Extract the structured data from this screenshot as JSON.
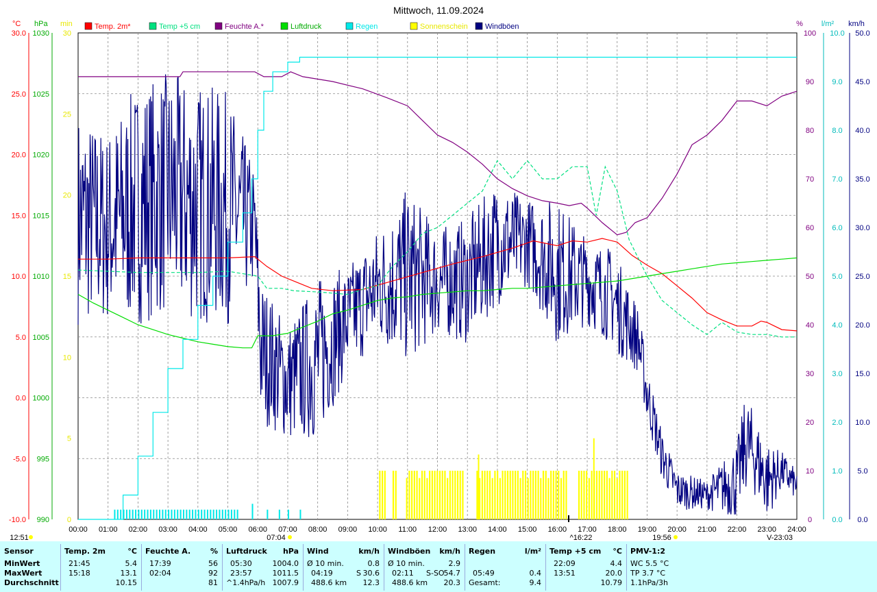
{
  "chart_data": {
    "type": "line",
    "title": "Mittwoch, 11.09.2024",
    "x_ticks": [
      "00:00",
      "01:00",
      "02:00",
      "03:00",
      "04:00",
      "05:00",
      "06:00",
      "07:00",
      "08:00",
      "09:00",
      "10:00",
      "11:00",
      "12:00",
      "13:00",
      "14:00",
      "15:00",
      "16:00",
      "17:00",
      "18:00",
      "19:00",
      "20:00",
      "21:00",
      "22:00",
      "23:00",
      "24:00"
    ],
    "axes": {
      "temp": {
        "unit": "°C",
        "min": -10,
        "max": 30,
        "ticks": [
          "30.0",
          "25.0",
          "20.0",
          "15.0",
          "10.0",
          "5.0",
          "0.0",
          "-5.0",
          "-10.0"
        ]
      },
      "press": {
        "unit": "hPa",
        "min": 990,
        "max": 1030,
        "ticks": [
          "1030",
          "1025",
          "1020",
          "1015",
          "1010",
          "1005",
          "1000",
          "995",
          "990"
        ]
      },
      "sun": {
        "unit": "min",
        "min": 0,
        "max": 30,
        "ticks": [
          "30",
          "25",
          "20",
          "15",
          "10",
          "5",
          "0"
        ]
      },
      "hum": {
        "unit": "%",
        "min": 0,
        "max": 100,
        "ticks": [
          "100",
          "90",
          "80",
          "70",
          "60",
          "50",
          "40",
          "30",
          "20",
          "10",
          "0"
        ]
      },
      "rain": {
        "unit": "l/m²",
        "min": 0,
        "max": 10,
        "ticks": [
          "10.0",
          "9.0",
          "8.0",
          "7.0",
          "6.0",
          "5.0",
          "4.0",
          "3.0",
          "2.0",
          "1.0",
          "0.0"
        ]
      },
      "wind": {
        "unit": "km/h",
        "min": 0,
        "max": 50,
        "ticks": [
          "50.0",
          "45.0",
          "40.0",
          "35.0",
          "30.0",
          "25.0",
          "20.0",
          "15.0",
          "10.0",
          "5.0",
          "0.0"
        ]
      }
    },
    "legend": [
      {
        "name": "Temp. 2m*",
        "color": "#ff0000"
      },
      {
        "name": "Temp +5 cm",
        "color": "#00e080"
      },
      {
        "name": "Feuchte A.*",
        "color": "#800080"
      },
      {
        "name": "Luftdruck",
        "color": "#00dd00"
      },
      {
        "name": "Regen",
        "color": "#00e8e8"
      },
      {
        "name": "Sonnenschein",
        "color": "#ffff00"
      },
      {
        "name": "Windböen",
        "color": "#000080"
      }
    ],
    "series": [
      {
        "name": "Temp. 2m*",
        "axis": "temp",
        "color": "#ff0000",
        "style": "solid",
        "points": [
          [
            0,
            11.4
          ],
          [
            1,
            11.4
          ],
          [
            2,
            11.5
          ],
          [
            3,
            11.5
          ],
          [
            4,
            11.5
          ],
          [
            5,
            11.5
          ],
          [
            5.9,
            11.6
          ],
          [
            6.3,
            10.8
          ],
          [
            6.8,
            10
          ],
          [
            7.3,
            9.5
          ],
          [
            7.8,
            9
          ],
          [
            8.5,
            8.8
          ],
          [
            9.5,
            8.9
          ],
          [
            10.5,
            9.6
          ],
          [
            11.5,
            10.3
          ],
          [
            12.5,
            11
          ],
          [
            13.5,
            11.6
          ],
          [
            14.5,
            12.3
          ],
          [
            15.2,
            12.9
          ],
          [
            16,
            12.5
          ],
          [
            16.5,
            12.9
          ],
          [
            17,
            12.8
          ],
          [
            17.5,
            13.1
          ],
          [
            18,
            12.8
          ],
          [
            18.5,
            11.7
          ],
          [
            19,
            10.9
          ],
          [
            19.5,
            10.2
          ],
          [
            20,
            9.2
          ],
          [
            20.5,
            8.2
          ],
          [
            21,
            7
          ],
          [
            21.5,
            6.4
          ],
          [
            22,
            5.9
          ],
          [
            22.5,
            5.9
          ],
          [
            22.8,
            6.3
          ],
          [
            23,
            6.2
          ],
          [
            23.5,
            5.6
          ],
          [
            24,
            5.5
          ]
        ]
      },
      {
        "name": "Temp +5 cm",
        "axis": "temp",
        "color": "#00e080",
        "style": "dashed",
        "points": [
          [
            0,
            10.5
          ],
          [
            1,
            10.4
          ],
          [
            2,
            10.3
          ],
          [
            3,
            10.3
          ],
          [
            4,
            10.3
          ],
          [
            5,
            10.4
          ],
          [
            6,
            10
          ],
          [
            6.3,
            9
          ],
          [
            6.8,
            9
          ],
          [
            7.2,
            8.8
          ],
          [
            8,
            8.7
          ],
          [
            9,
            8.5
          ],
          [
            9.6,
            9
          ],
          [
            10,
            9.2
          ],
          [
            10.5,
            10.8
          ],
          [
            11,
            12
          ],
          [
            11.5,
            13.5
          ],
          [
            12,
            14
          ],
          [
            12.5,
            15
          ],
          [
            13,
            16
          ],
          [
            13.5,
            17
          ],
          [
            14,
            19.5
          ],
          [
            14.5,
            18
          ],
          [
            15,
            19.5
          ],
          [
            15.5,
            18
          ],
          [
            16,
            18
          ],
          [
            16.5,
            19
          ],
          [
            17,
            19
          ],
          [
            17.3,
            15
          ],
          [
            17.6,
            19
          ],
          [
            18,
            17
          ],
          [
            18.4,
            13
          ],
          [
            19,
            10
          ],
          [
            19.5,
            8
          ],
          [
            20,
            7
          ],
          [
            20.5,
            6
          ],
          [
            21,
            5.2
          ],
          [
            21.5,
            6.2
          ],
          [
            22,
            5.4
          ],
          [
            22.5,
            5.2
          ],
          [
            23,
            5.2
          ],
          [
            23.5,
            5
          ],
          [
            24,
            5
          ]
        ]
      },
      {
        "name": "Feuchte A.*",
        "axis": "hum",
        "color": "#800080",
        "style": "solid",
        "points": [
          [
            0,
            91
          ],
          [
            3.4,
            91
          ],
          [
            3.5,
            92
          ],
          [
            5.9,
            92
          ],
          [
            6.2,
            91
          ],
          [
            6.8,
            91
          ],
          [
            7.1,
            92
          ],
          [
            7.5,
            91
          ],
          [
            8.5,
            90
          ],
          [
            9.5,
            88.5
          ],
          [
            10.3,
            86.7
          ],
          [
            11,
            85
          ],
          [
            11.5,
            82
          ],
          [
            12,
            79
          ],
          [
            12.5,
            77.5
          ],
          [
            13,
            75.5
          ],
          [
            13.5,
            73
          ],
          [
            14,
            70
          ],
          [
            14.5,
            68
          ],
          [
            15,
            66.5
          ],
          [
            15.5,
            65.5
          ],
          [
            16,
            65
          ],
          [
            16.4,
            64.5
          ],
          [
            16.8,
            65
          ],
          [
            17,
            64
          ],
          [
            17.5,
            61
          ],
          [
            18,
            58.5
          ],
          [
            18.3,
            59
          ],
          [
            18.6,
            61
          ],
          [
            19,
            62
          ],
          [
            19.5,
            66
          ],
          [
            20,
            71
          ],
          [
            20.5,
            77
          ],
          [
            21,
            79
          ],
          [
            21.5,
            82
          ],
          [
            22,
            86
          ],
          [
            22.5,
            86
          ],
          [
            23,
            85
          ],
          [
            23.5,
            87
          ],
          [
            24,
            88
          ]
        ]
      },
      {
        "name": "Luftdruck",
        "axis": "press",
        "color": "#00dd00",
        "style": "solid",
        "points": [
          [
            0,
            1008.5
          ],
          [
            0.5,
            1007.8
          ],
          [
            1,
            1007.2
          ],
          [
            1.5,
            1006.6
          ],
          [
            2,
            1006
          ],
          [
            2.5,
            1005.6
          ],
          [
            3,
            1005.2
          ],
          [
            3.5,
            1004.9
          ],
          [
            4,
            1004.6
          ],
          [
            4.5,
            1004.4
          ],
          [
            5,
            1004.2
          ],
          [
            5.5,
            1004.1
          ],
          [
            5.8,
            1004.1
          ],
          [
            6,
            1005.1
          ],
          [
            6.5,
            1005.1
          ],
          [
            7,
            1005.3
          ],
          [
            7.5,
            1005.8
          ],
          [
            8,
            1006.3
          ],
          [
            8.5,
            1006.9
          ],
          [
            9,
            1007.2
          ],
          [
            9.5,
            1007.6
          ],
          [
            10,
            1008
          ],
          [
            10.5,
            1008.2
          ],
          [
            11,
            1008.3
          ],
          [
            11.5,
            1008.5
          ],
          [
            12,
            1008.6
          ],
          [
            12.5,
            1008.7
          ],
          [
            13,
            1008.8
          ],
          [
            13.5,
            1008.8
          ],
          [
            14,
            1008.9
          ],
          [
            14.5,
            1009
          ],
          [
            15,
            1009
          ],
          [
            15.5,
            1009.1
          ],
          [
            16,
            1009.2
          ],
          [
            16.5,
            1009.3
          ],
          [
            17,
            1009.4
          ],
          [
            17.5,
            1009.5
          ],
          [
            18,
            1009.6
          ],
          [
            18.5,
            1009.8
          ],
          [
            19,
            1010
          ],
          [
            19.5,
            1010.2
          ],
          [
            20,
            1010.4
          ],
          [
            20.5,
            1010.6
          ],
          [
            21,
            1010.8
          ],
          [
            21.5,
            1011
          ],
          [
            22,
            1011.1
          ],
          [
            22.5,
            1011.2
          ],
          [
            23,
            1011.3
          ],
          [
            23.5,
            1011.4
          ],
          [
            24,
            1011.5
          ]
        ]
      },
      {
        "name": "Regen",
        "axis": "rain",
        "color": "#00e8e8",
        "style": "solid",
        "points": [
          [
            0,
            0
          ],
          [
            1.2,
            0
          ],
          [
            1.5,
            0.5
          ],
          [
            2,
            1.3
          ],
          [
            2.5,
            2.2
          ],
          [
            3,
            3.1
          ],
          [
            3.5,
            3.7
          ],
          [
            4,
            4.4
          ],
          [
            4.5,
            5
          ],
          [
            5,
            5.7
          ],
          [
            5.5,
            6.3
          ],
          [
            5.8,
            7
          ],
          [
            6,
            8
          ],
          [
            6.2,
            8.8
          ],
          [
            6.5,
            9.2
          ],
          [
            7,
            9.4
          ],
          [
            7.3,
            9.4
          ],
          [
            7.4,
            9.5
          ],
          [
            24,
            9.5
          ]
        ]
      },
      {
        "name": "Windböen",
        "axis": "wind",
        "color": "#000080",
        "style": "solid",
        "envelope": [
          [
            0,
            20,
            42
          ],
          [
            1,
            20,
            40
          ],
          [
            2,
            20,
            45
          ],
          [
            3,
            21,
            46
          ],
          [
            4,
            20,
            45
          ],
          [
            5,
            20,
            44
          ],
          [
            5.9,
            24,
            36
          ],
          [
            6.1,
            10,
            25
          ],
          [
            7,
            8,
            20
          ],
          [
            8,
            8,
            25
          ],
          [
            9,
            15,
            26
          ],
          [
            10,
            18,
            30
          ],
          [
            11,
            16,
            34
          ],
          [
            12,
            19,
            30
          ],
          [
            13,
            18,
            31
          ],
          [
            14,
            22,
            35
          ],
          [
            15,
            24,
            33
          ],
          [
            16,
            18,
            33
          ],
          [
            17,
            20,
            29
          ],
          [
            17.8,
            18,
            28
          ],
          [
            18,
            17,
            27
          ],
          [
            18.7,
            15,
            22
          ],
          [
            19,
            10,
            16
          ],
          [
            19.5,
            4,
            9
          ],
          [
            20,
            1,
            5
          ],
          [
            21,
            1,
            4
          ],
          [
            22,
            0,
            8
          ],
          [
            22.3,
            3,
            13
          ],
          [
            22.7,
            2,
            10
          ],
          [
            23,
            0,
            8
          ],
          [
            23.5,
            3,
            7
          ],
          [
            24,
            2,
            5
          ]
        ]
      },
      {
        "name": "Sonnenschein",
        "axis": "sun",
        "color": "#ffff00",
        "type": "bar",
        "spans": [
          [
            10.05,
            10.3,
            3
          ],
          [
            10.5,
            10.6,
            3
          ],
          [
            10.95,
            12.9,
            3
          ],
          [
            13.3,
            16.3,
            3
          ],
          [
            16.7,
            18.4,
            3
          ]
        ],
        "peaks": [
          [
            13.35,
            4
          ],
          [
            17.2,
            5
          ]
        ]
      }
    ],
    "rain_ticks": [
      [
        1.2,
        3.1,
        0.5
      ],
      [
        3.1,
        5.3,
        0.5
      ],
      [
        5.8,
        0.8
      ],
      [
        6.3,
        0.5
      ],
      [
        6.7,
        0.5
      ],
      [
        7,
        0.5
      ],
      [
        7.4,
        0.5
      ]
    ],
    "markers": {
      "sunrise": "07:04",
      "noon": "12:51",
      "sunset": "19:56",
      "event1": "^16:22",
      "event2": "V-23:03"
    }
  },
  "footer": {
    "sensor": {
      "title": "Sensor",
      "rows": [
        "MinWert",
        "MaxWert",
        "Durchschnitt"
      ]
    },
    "temp": {
      "title": "Temp. 2m",
      "unit": "°C",
      "min_time": "21:45",
      "min_val": "5.4",
      "max_time": "15:18",
      "max_val": "13.1",
      "avg": "10.15"
    },
    "hum": {
      "title": "Feuchte A.",
      "unit": "%",
      "min_time": "17:39",
      "min_val": "56",
      "max_time": "02:04",
      "max_val": "92",
      "avg": "81"
    },
    "press": {
      "title": "Luftdruck",
      "unit": "hPa",
      "min_time": "05:30",
      "min_val": "1004.0",
      "max_time": "23:57",
      "max_val": "1011.5",
      "trend": "^1.4hPa/h",
      "avg": "1007.9"
    },
    "wind": {
      "title": "Wind",
      "unit": "km/h",
      "min_label": "Ø 10 min.",
      "min_val": "0.8",
      "max_time": "04:19",
      "max_dir": "S",
      "max_val": "30.6",
      "dist": "488.6 km",
      "avg": "12.3"
    },
    "gust": {
      "title": "Windböen",
      "unit": "km/h",
      "min_label": "Ø 10 min.",
      "min_val": "2.9",
      "max_time": "02:11",
      "max_dir": "S-SO",
      "max_val": "54.7",
      "dist": "488.6 km",
      "avg": "20.3"
    },
    "rain": {
      "title": "Regen",
      "unit": "l/m²",
      "max_time": "05:49",
      "max_val": "0.4",
      "total_label": "Gesamt:",
      "total": "9.4"
    },
    "temp5": {
      "title": "Temp +5 cm",
      "unit": "°C",
      "min_time": "22:09",
      "min_val": "4.4",
      "max_time": "13:51",
      "max_val": "20.0",
      "avg": "10.79"
    },
    "pmv": {
      "title": "PMV-1:2",
      "wc": "WC 5.5 °C",
      "tp": "TP 3.7 °C",
      "trend": "1.1hPa/3h"
    }
  }
}
